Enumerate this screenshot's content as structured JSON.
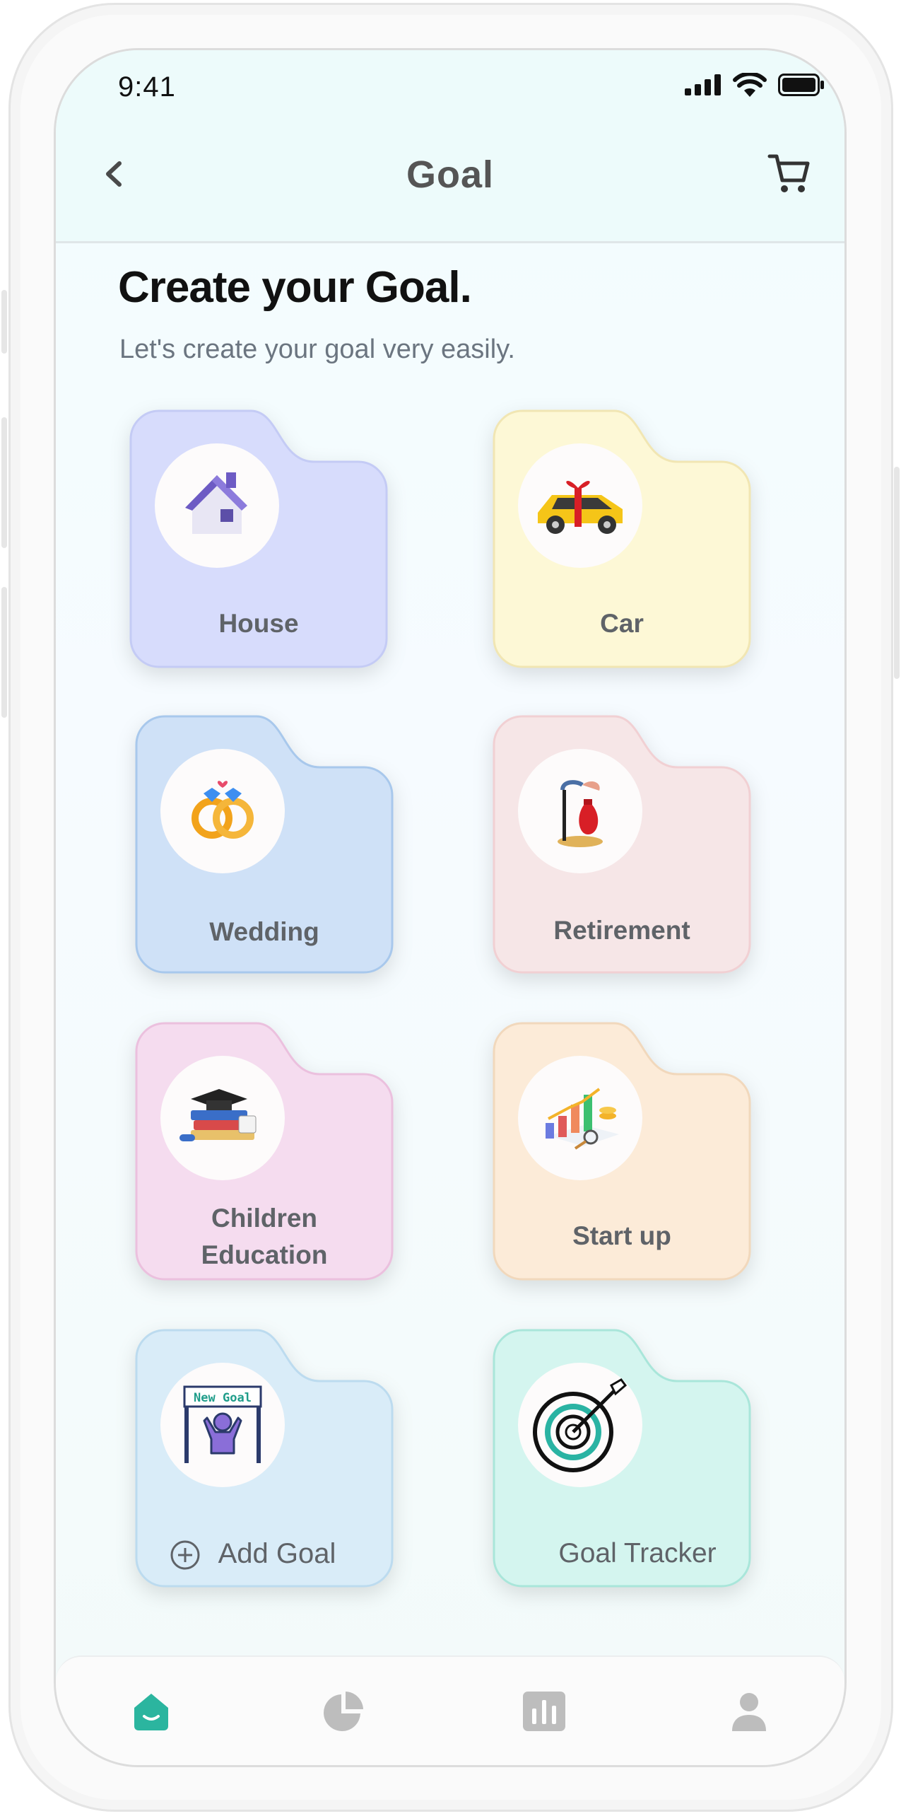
{
  "status_bar": {
    "time": "9:41"
  },
  "header": {
    "title": "Goal"
  },
  "page": {
    "heading": "Create your Goal.",
    "subheading": "Let's create your goal very easily."
  },
  "goals": [
    {
      "label": "House",
      "icon": "house-icon",
      "color": "#d7dcfc"
    },
    {
      "label": "Car",
      "icon": "gift-car-icon",
      "color": "#fdf8d6"
    },
    {
      "label": "Wedding",
      "icon": "wedding-rings-icon",
      "color": "#cfe1f7"
    },
    {
      "label": "Retirement",
      "icon": "money-bag-icon",
      "color": "#f6e6e7"
    },
    {
      "label": "Children\nEducation",
      "icon": "books-graduation-cap-icon",
      "color": "#f5dcef"
    },
    {
      "label": "Start up",
      "icon": "growth-chart-icon",
      "color": "#fcebd8"
    },
    {
      "label": "Add Goal",
      "icon": "new-goal-icon",
      "color": "#d9ecf8"
    },
    {
      "label": "Goal Tracker",
      "icon": "target-icon",
      "color": "#d4f5ef"
    }
  ],
  "bottom_nav": [
    {
      "name": "home",
      "icon": "home-icon",
      "active": true
    },
    {
      "name": "portfolio",
      "icon": "pie-chart-icon",
      "active": false
    },
    {
      "name": "stats",
      "icon": "bar-chart-icon",
      "active": false
    },
    {
      "name": "profile",
      "icon": "user-icon",
      "active": false
    }
  ],
  "colors": {
    "accent": "#2bb59f",
    "inactive": "#b9b9b9"
  }
}
